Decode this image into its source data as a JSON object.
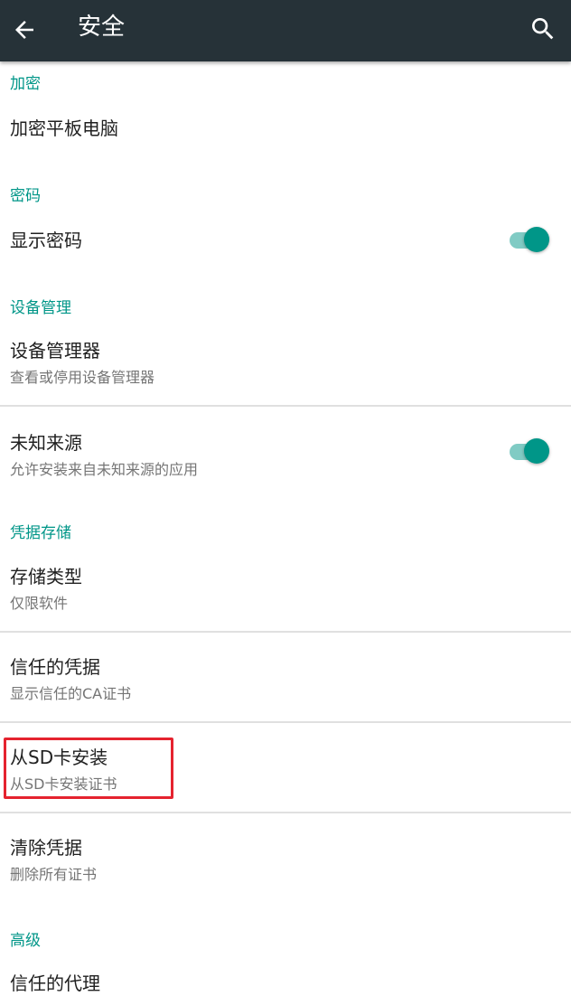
{
  "appbar": {
    "title": "安全",
    "back_icon": "arrow-back-icon",
    "search_icon": "search-icon"
  },
  "colors": {
    "appbar_bg": "#263238",
    "accent": "#009688",
    "highlight": "#e5232f"
  },
  "sections": {
    "encryption": {
      "header": "加密",
      "items": [
        {
          "title": "加密平板电脑"
        }
      ]
    },
    "passwords": {
      "header": "密码",
      "items": [
        {
          "title": "显示密码",
          "toggle": true
        }
      ]
    },
    "device_admin": {
      "header": "设备管理",
      "items": [
        {
          "title": "设备管理器",
          "subtitle": "查看或停用设备管理器"
        },
        {
          "title": "未知来源",
          "subtitle": "允许安装来自未知来源的应用",
          "toggle": true
        }
      ]
    },
    "credential_storage": {
      "header": "凭据存储",
      "items": [
        {
          "title": "存储类型",
          "subtitle": "仅限软件"
        },
        {
          "title": "信任的凭据",
          "subtitle": "显示信任的CA证书"
        },
        {
          "title": "从SD卡安装",
          "subtitle": "从SD卡安装证书"
        },
        {
          "title": "清除凭据",
          "subtitle": "删除所有证书"
        }
      ]
    },
    "advanced": {
      "header": "高级",
      "items": [
        {
          "title": "信任的代理"
        }
      ]
    }
  }
}
